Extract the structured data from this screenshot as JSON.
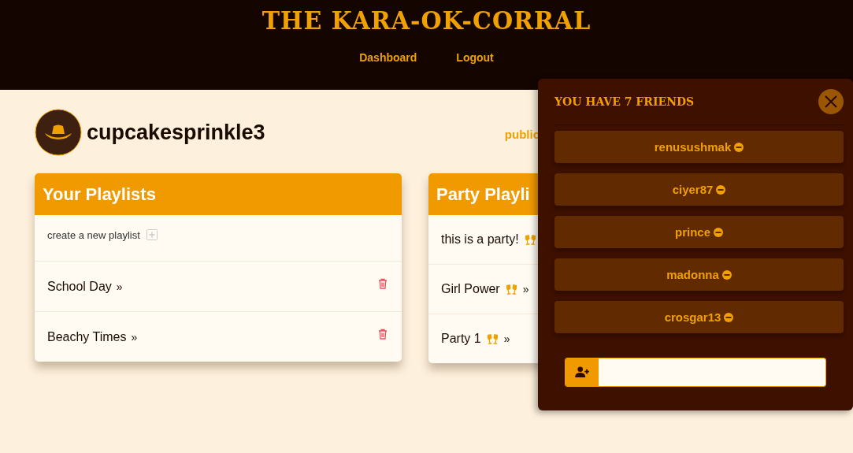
{
  "header": {
    "title": "THE KARA-OK-CORRAL",
    "nav": [
      "Dashboard",
      "Logout"
    ]
  },
  "profile": {
    "username": "cupcakesprinkle3",
    "link": "public"
  },
  "your_playlists": {
    "title": "Your Playlists",
    "create_label": "create a new playlist",
    "items": [
      {
        "name": "School Day",
        "arrow": "»"
      },
      {
        "name": "Beachy Times",
        "arrow": "»"
      }
    ]
  },
  "party_playlists": {
    "title": "Party Playli",
    "items": [
      {
        "name": "this is a party!"
      },
      {
        "name": "Girl Power",
        "arrow": "»"
      },
      {
        "name": "Party 1",
        "arrow": "»"
      }
    ]
  },
  "friends_panel": {
    "title": "YOU HAVE 7 FRIENDS",
    "friends": [
      "renusushmak",
      "ciyer87",
      "prince",
      "madonna",
      "crosgar13"
    ]
  }
}
